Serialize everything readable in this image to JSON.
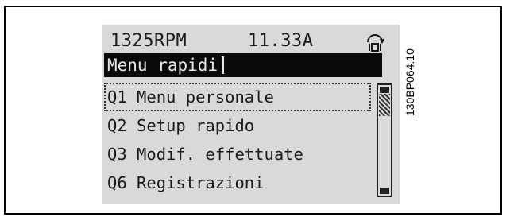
{
  "status": {
    "speed": "1325RPM",
    "current": "11.33A",
    "setup_icon": "setup-indicator-icon"
  },
  "title": "Menu rapidi",
  "menu": {
    "items": [
      {
        "label": "Q1 Menu personale",
        "selected": true
      },
      {
        "label": "Q2 Setup rapido",
        "selected": false
      },
      {
        "label": "Q3 Modif. effettuate",
        "selected": false
      },
      {
        "label": "Q6 Registrazioni",
        "selected": false
      }
    ]
  },
  "figure_code": "130BP064.10"
}
